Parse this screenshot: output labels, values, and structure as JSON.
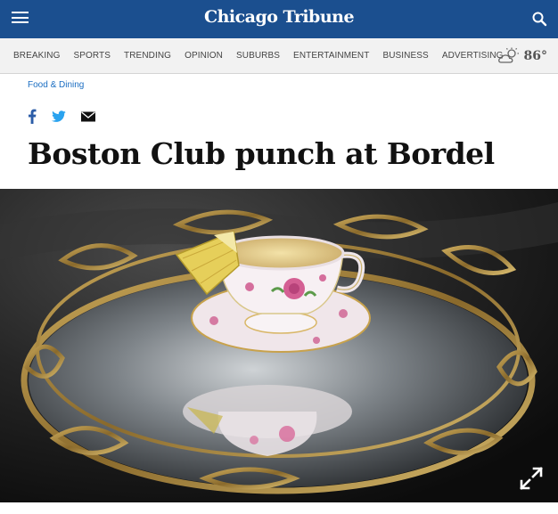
{
  "header": {
    "logo": "Chicago Tribune",
    "menu_icon": "hamburger-menu-icon",
    "search_icon": "search-icon",
    "brand_color": "#1b4f8f"
  },
  "nav": {
    "items": [
      "BREAKING",
      "SPORTS",
      "TRENDING",
      "OPINION",
      "SUBURBS",
      "ENTERTAINMENT",
      "BUSINESS",
      "ADVERTISING"
    ]
  },
  "weather": {
    "icon": "partly-cloudy-sun-icon",
    "temperature": "86°"
  },
  "article": {
    "section": "Food & Dining",
    "headline": "Boston Club punch at Bordel",
    "share_icons": [
      "facebook-icon",
      "twitter-icon",
      "email-icon"
    ],
    "image_alt_semantics": "teacup-of-punch-on-mirrored-gold-tray",
    "expand_icon": "expand-arrows-icon"
  }
}
